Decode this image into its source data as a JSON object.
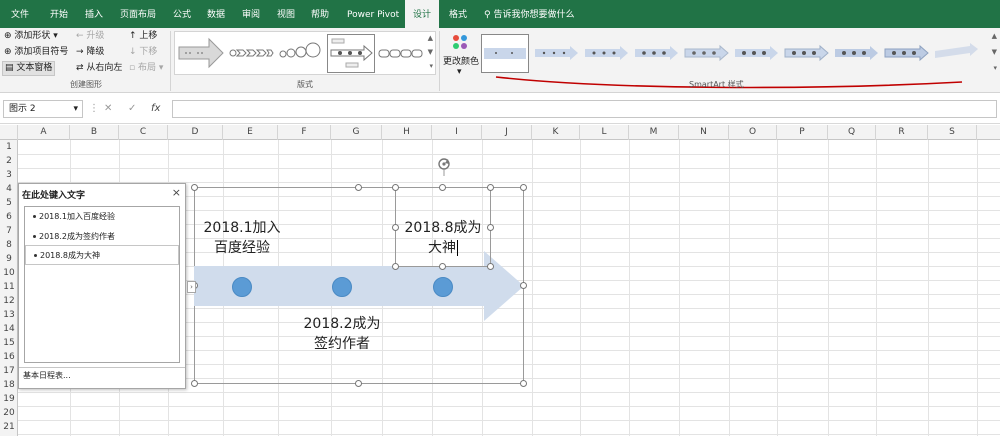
{
  "tabs": [
    {
      "label": "文件",
      "active": false
    },
    {
      "label": "开始",
      "active": false
    },
    {
      "label": "插入",
      "active": false
    },
    {
      "label": "页面布局",
      "active": false
    },
    {
      "label": "公式",
      "active": false
    },
    {
      "label": "数据",
      "active": false
    },
    {
      "label": "审阅",
      "active": false
    },
    {
      "label": "视图",
      "active": false
    },
    {
      "label": "帮助",
      "active": false
    },
    {
      "label": "Power Pivot",
      "active": false
    },
    {
      "label": "设计",
      "active": true
    },
    {
      "label": "格式",
      "active": false
    }
  ],
  "tell_me": "告诉我你想要做什么",
  "create_graphic": {
    "add_shape": "添加形状",
    "add_bullet": "添加项目符号",
    "text_pane": "文本窗格",
    "promote": "升级",
    "demote": "降级",
    "right_to_left": "从右向左",
    "move_up": "上移",
    "move_down": "下移",
    "layout": "布局",
    "group_label": "创建图形"
  },
  "layouts": {
    "group_label": "版式"
  },
  "styles": {
    "change_colors": "更改颜色",
    "group_label": "SmartArt 样式"
  },
  "formula_bar": {
    "name_box": "图示 2",
    "cancel": "✕",
    "enter": "✓",
    "fx": "fx",
    "value": ""
  },
  "columns": [
    "A",
    "B",
    "C",
    "D",
    "E",
    "F",
    "G",
    "H",
    "I",
    "J",
    "K",
    "L",
    "M",
    "N",
    "O",
    "P",
    "Q",
    "R",
    "S"
  ],
  "rows": [
    "1",
    "2",
    "3",
    "4",
    "5",
    "6",
    "7",
    "8",
    "9",
    "10",
    "11",
    "12",
    "13",
    "14",
    "15",
    "16",
    "17",
    "18",
    "19",
    "20",
    "21"
  ],
  "text_pane": {
    "title": "在此处键入文字",
    "close": "×",
    "items": [
      "2018.1加入百度经验",
      "2018.2成为签约作者",
      "2018.8成为大神"
    ],
    "footer": "基本日程表..."
  },
  "smartart": {
    "item1_line1": "2018.1加入",
    "item1_line2": "百度经验",
    "item2_line1": "2018.2成为",
    "item2_line2": "签约作者",
    "item3_line1": "2018.8成为",
    "item3_line2": "大神",
    "arrow_color": "#d0dcec",
    "dot_color": "#5b9bd5"
  },
  "colors": {
    "ribbon_green": "#217346",
    "annotation_red": "#c00000"
  }
}
